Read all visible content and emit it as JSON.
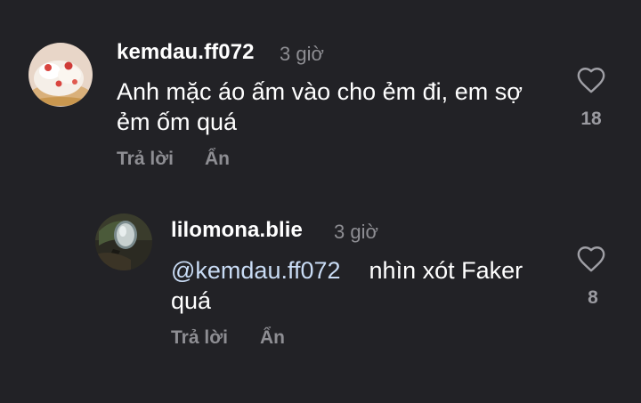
{
  "comments": [
    {
      "username": "kemdau.ff072",
      "time": "3 giờ",
      "text_line1": "Anh mặc áo ấm vào cho ẻm đi, em sợ",
      "text_line2": "ẻm ốm quá",
      "reply_label": "Trả lời",
      "hide_label": "Ẩn",
      "likes": "18",
      "avatar_icon": "cake-avatar"
    },
    {
      "username": "lilomona.blie",
      "time": "3 giờ",
      "mention": "@kemdau.ff072",
      "text_after_mention": "nhìn xót Faker",
      "text_line2": "quá",
      "reply_label": "Trả lời",
      "hide_label": "Ẩn",
      "likes": "8",
      "avatar_icon": "mirror-avatar"
    }
  ],
  "colors": {
    "background": "#222226",
    "secondary_text": "#8e8e93",
    "mention": "#c9dcf5"
  }
}
